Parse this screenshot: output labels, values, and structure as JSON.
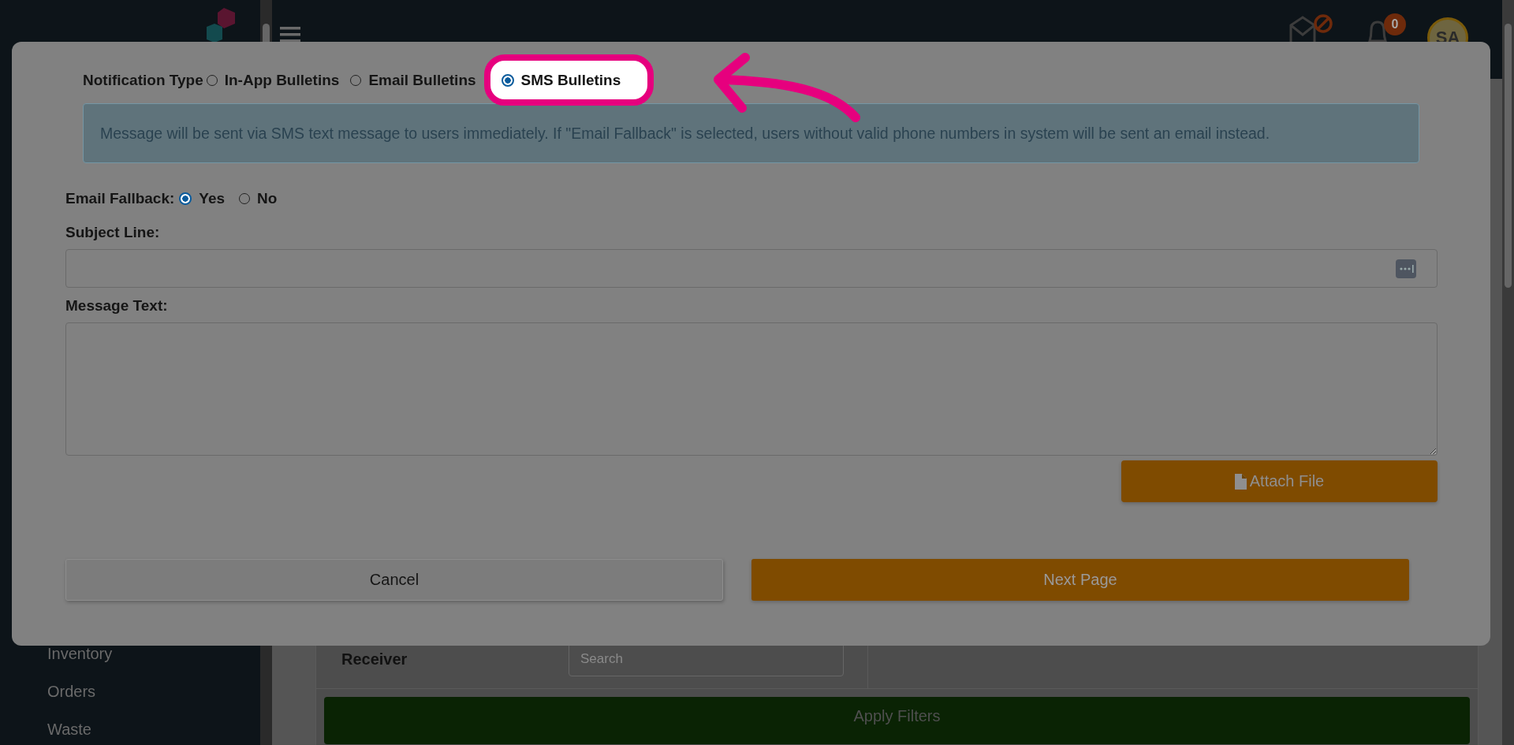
{
  "topbar": {
    "notification_count": "0",
    "avatar": "SA"
  },
  "sidebar": {
    "items": [
      "Inventory",
      "Orders",
      "Waste"
    ]
  },
  "filters": {
    "receiver_label": "Receiver",
    "search_placeholder": "Search",
    "apply_button": "Apply Filters"
  },
  "modal": {
    "notification_type": {
      "label": "Notification Type",
      "options": [
        {
          "label": "In-App Bulletins",
          "selected": false,
          "highlighted": false
        },
        {
          "label": "Email Bulletins",
          "selected": false,
          "highlighted": false
        },
        {
          "label": "SMS Bulletins",
          "selected": true,
          "highlighted": true
        }
      ]
    },
    "info": "Message will be sent via SMS text message to users immediately. If \"Email Fallback\" is selected, users without valid phone numbers in system will be sent an email instead.",
    "email_fallback": {
      "label": "Email Fallback:",
      "options": [
        {
          "label": "Yes",
          "selected": true
        },
        {
          "label": "No",
          "selected": false
        }
      ]
    },
    "subject": {
      "label": "Subject Line:"
    },
    "message": {
      "label": "Message Text:"
    },
    "attach_button": "Attach File",
    "cancel_button": "Cancel",
    "next_button": "Next Page"
  }
}
